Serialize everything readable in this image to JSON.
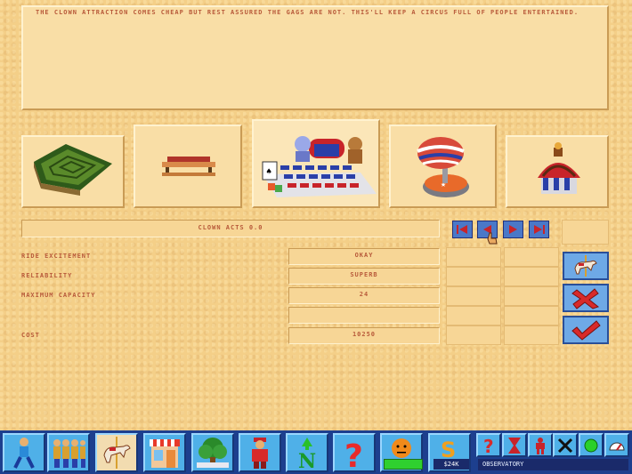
{
  "description": "THE CLOWN ATTRACTION COMES CHEAP BUT REST ASSURED THE GAGS ARE NOT. THIS'LL KEEP A CIRCUS FULL OF PEOPLE ENTERTAINED.",
  "carousel": {
    "items": [
      {
        "name": "hedge-maze-attraction",
        "selected": false
      },
      {
        "name": "bench-attraction",
        "selected": false
      },
      {
        "name": "clown-acts-attraction",
        "selected": true
      },
      {
        "name": "spinning-top-attraction",
        "selected": false
      },
      {
        "name": "observatory-attraction",
        "selected": false
      }
    ]
  },
  "ride_name": "CLOWN ACTS 0.0",
  "stats": [
    {
      "label": "RIDE EXCITEMENT",
      "value": "OKAY"
    },
    {
      "label": "RELIABILITY",
      "value": "SUPERB"
    },
    {
      "label": "MAXIMUM CAPACITY",
      "value": "24"
    },
    {
      "label": "",
      "value": ""
    },
    {
      "label": "COST",
      "value": "10250"
    }
  ],
  "nav": [
    "first-icon",
    "previous-icon",
    "next-icon",
    "last-icon"
  ],
  "actions": [
    "carousel-horse-icon",
    "cancel-x-icon",
    "confirm-check-icon"
  ],
  "toolbar": {
    "buttons": [
      "visitor-icon",
      "staff-icon",
      "rides-icon",
      "shops-icon",
      "scenery-icon",
      "security-guard-icon",
      "map-north-icon",
      "help-icon",
      "happiness-face-icon",
      "money-icon"
    ],
    "small_buttons": [
      "question-icon",
      "hourglass-icon",
      "person-icon",
      "tools-icon",
      "green-light-icon",
      "speed-gauge-icon"
    ],
    "money": "$24K",
    "status": "OBSERVATORY"
  },
  "colors": {
    "text": "#b85a3a",
    "panel": "#f9dea6",
    "toolbar": "#1d3f8e",
    "button": "#4fb0e8"
  }
}
